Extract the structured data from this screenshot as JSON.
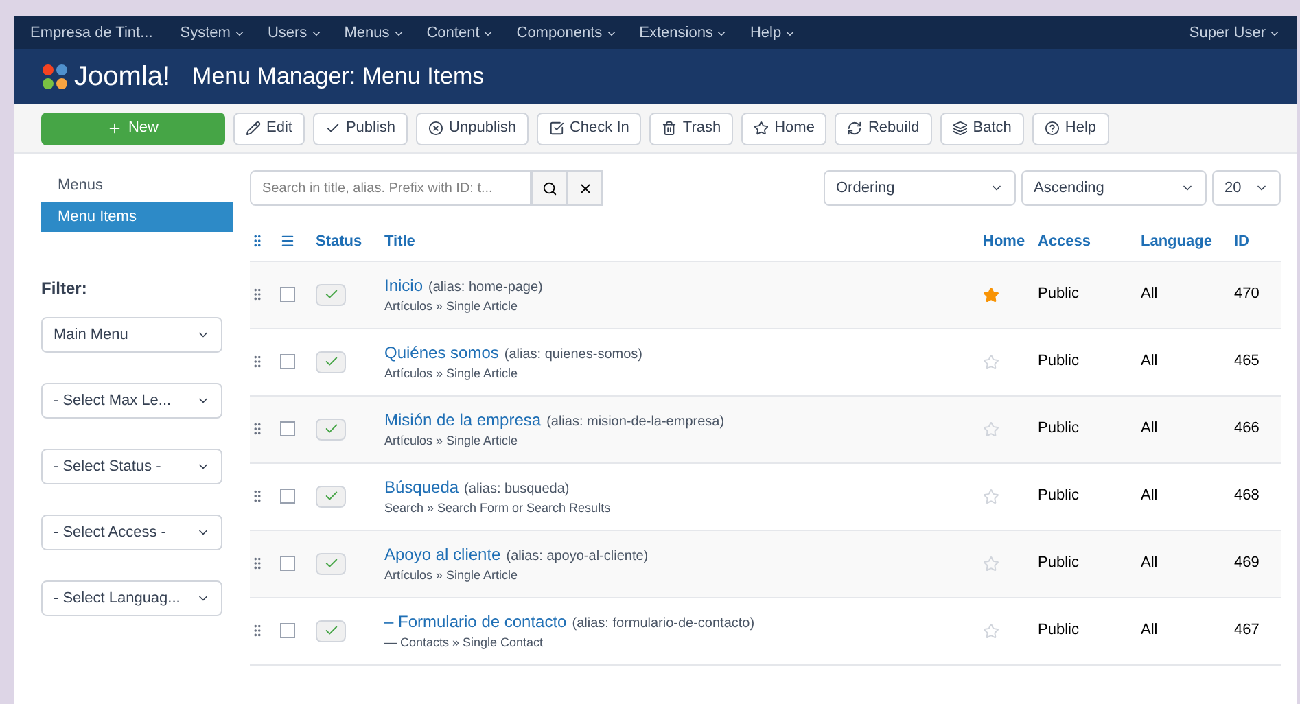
{
  "top_menu": {
    "site": "Empresa de Tint...",
    "items": [
      "System",
      "Users",
      "Menus",
      "Content",
      "Components",
      "Extensions",
      "Help"
    ],
    "user": "Super User"
  },
  "header": {
    "logo": "Joomla!",
    "title": "Menu Manager: Menu Items"
  },
  "toolbar": [
    {
      "kind": "primary",
      "label": "New"
    },
    {
      "kind": "plain",
      "label": "Edit"
    },
    {
      "kind": "plain",
      "label": "Publish"
    },
    {
      "kind": "plain",
      "label": "Unpublish"
    },
    {
      "kind": "plain",
      "label": "Check In"
    },
    {
      "kind": "plain",
      "label": "Trash"
    },
    {
      "kind": "plain",
      "label": "Home"
    },
    {
      "kind": "plain",
      "label": "Rebuild"
    },
    {
      "kind": "plain",
      "label": "Batch"
    },
    {
      "kind": "plain",
      "label": "Help"
    }
  ],
  "sidebar": {
    "items": [
      {
        "label": "Menus",
        "selected": false
      },
      {
        "label": "Menu Items",
        "selected": true
      }
    ],
    "filter_label": "Filter:",
    "filters": [
      "Main Menu",
      "- Select Max Le...",
      "- Select Status -",
      "- Select Access -",
      "- Select Languag..."
    ]
  },
  "search": {
    "placeholder": "Search in title, alias. Prefix with ID: t..."
  },
  "sort": {
    "ordering": "Ordering",
    "direction": "Ascending",
    "limit": "20"
  },
  "table": {
    "columns": [
      "Status",
      "Title",
      "Home",
      "Access",
      "Language",
      "ID"
    ],
    "rows": [
      {
        "title": "Inicio",
        "alias": "(alias: home-page)",
        "type": "Artículos » Single Article",
        "checked": false,
        "published": true,
        "home": true,
        "access": "Public",
        "language": "All",
        "id": "470"
      },
      {
        "title": "Quiénes somos",
        "alias": "(alias: quienes-somos)",
        "type": "Artículos » Single Article",
        "checked": false,
        "published": true,
        "home": false,
        "access": "Public",
        "language": "All",
        "id": "465"
      },
      {
        "title": "Misión de la empresa",
        "alias": "(alias: mision-de-la-empresa)",
        "type": "Artículos » Single Article",
        "checked": false,
        "published": true,
        "home": false,
        "access": "Public",
        "language": "All",
        "id": "466"
      },
      {
        "title": "Búsqueda",
        "alias": "(alias: busqueda)",
        "type": "Search » Search Form or Search Results",
        "checked": false,
        "published": true,
        "home": false,
        "access": "Public",
        "language": "All",
        "id": "468"
      },
      {
        "title": "Apoyo al cliente",
        "alias": "(alias: apoyo-al-cliente)",
        "type": "Artículos » Single Article",
        "checked": false,
        "published": true,
        "home": false,
        "access": "Public",
        "language": "All",
        "id": "469"
      },
      {
        "title": "– Formulario de contacto",
        "alias": "(alias: formulario-de-contacto)",
        "type": "— Contacts » Single Contact",
        "checked": false,
        "published": true,
        "home": false,
        "access": "Public",
        "language": "All",
        "id": "467"
      }
    ]
  }
}
